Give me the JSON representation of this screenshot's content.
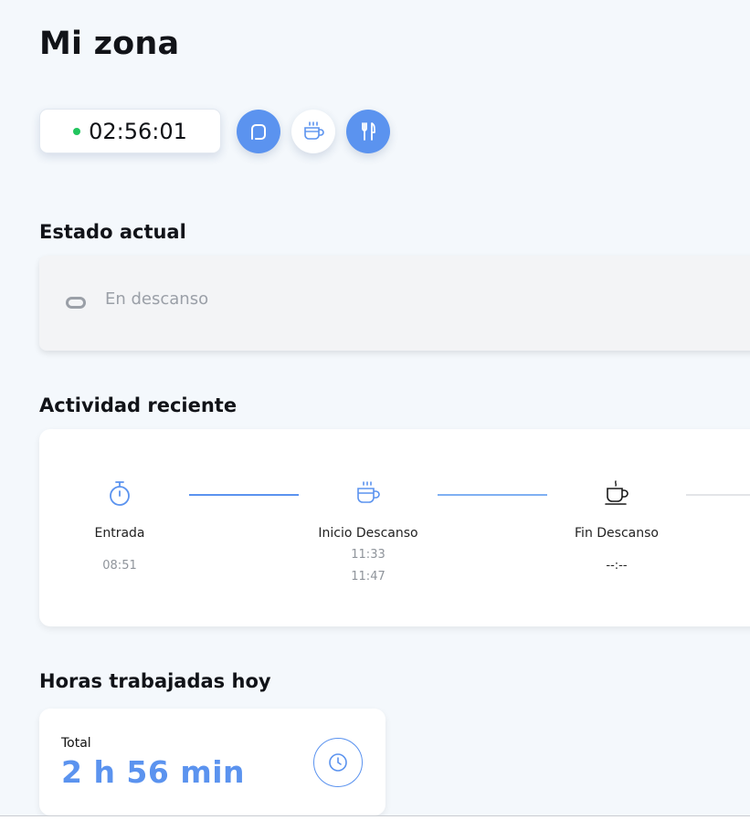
{
  "page": {
    "title": "Mi zona"
  },
  "timer": {
    "value": "02:56:01",
    "status_color": "#22c55e"
  },
  "actions": [
    {
      "icon": "rounded-square-icon",
      "style": "blue"
    },
    {
      "icon": "coffee-cup-icon",
      "style": "white"
    },
    {
      "icon": "fork-knife-icon",
      "style": "blue"
    }
  ],
  "current_state": {
    "title": "Estado actual",
    "label": "En descanso",
    "icon": "pause-pill-icon"
  },
  "activity": {
    "title": "Actividad reciente",
    "steps": [
      {
        "label": "Entrada",
        "times": [
          "08:51"
        ],
        "icon": "stopwatch-icon"
      },
      {
        "label": "Inicio Descanso",
        "times": [
          "11:33",
          "11:47"
        ],
        "icon": "coffee-cup-icon"
      },
      {
        "label": "Fin Descanso",
        "times": [
          "--:--"
        ],
        "icon": "coffee-cup-outline-icon"
      }
    ]
  },
  "hours": {
    "title": "Horas trabajadas hoy",
    "caption": "Total",
    "value": "2 h 56 min",
    "icon": "clock-icon"
  },
  "colors": {
    "accent": "#5b93ef",
    "background": "#f4f8fc",
    "status_on": "#22c55e",
    "muted_text": "#9a9fa7"
  }
}
